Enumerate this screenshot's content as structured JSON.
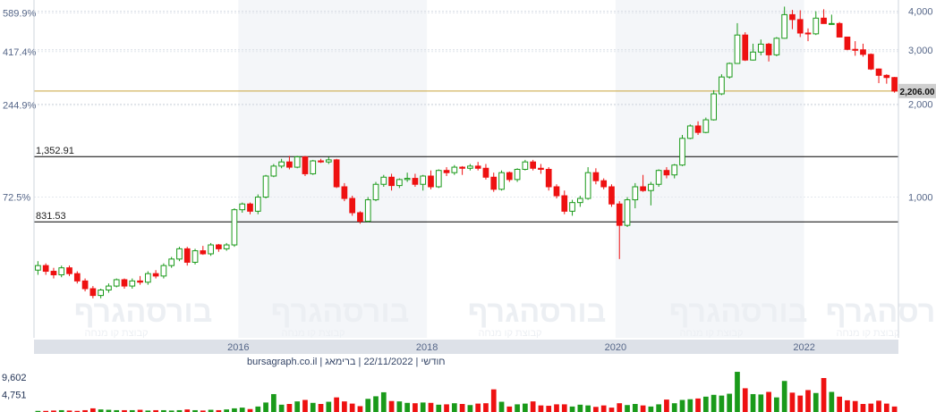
{
  "colors": {
    "up": "#1a9a1a",
    "down": "#ee1111",
    "current_line": "#c9a43c",
    "level_line": "#000000",
    "axis_text": "#556688",
    "band": "#f4f6f9",
    "axis_strip": "#dde1e8"
  },
  "footer_text": "חודשי | 22/11/2022 | ברימאג | bursagraph.co.il",
  "watermark": "בורסהגרף",
  "watermark_sub": "קבוצת קו מנחה",
  "chart_data": {
    "type": "candlestick",
    "period": "monthly",
    "price_axis": {
      "ticks": [
        1000,
        2000,
        3000,
        4000
      ],
      "tick_labels": [
        "1,000",
        "2,000",
        "3,000",
        "4,000"
      ],
      "ylim": [
        350,
        4180
      ]
    },
    "percent_axis": {
      "tick_prices": [
        1000,
        1985,
        2960,
        3950
      ],
      "tick_labels": [
        "72.5%",
        "244.9%",
        "417.4%",
        "589.9%"
      ]
    },
    "x_ticks": [
      {
        "label": "2016",
        "index": 26
      },
      {
        "label": "2018",
        "index": 50
      },
      {
        "label": "2020",
        "index": 74
      },
      {
        "label": "2022",
        "index": 98
      }
    ],
    "current_price": {
      "value": 2206,
      "label": "2,206.00"
    },
    "levels": [
      {
        "value": 1352.91,
        "label": "1,352.91"
      },
      {
        "value": 831.53,
        "label": "831.53"
      }
    ],
    "volume_axis": {
      "ticks": [
        4751,
        9602
      ],
      "tick_labels": [
        "4,751",
        "9,602"
      ],
      "max": 11500
    },
    "candles": [
      {
        "o": 580,
        "h": 620,
        "l": 560,
        "c": 600
      },
      {
        "o": 600,
        "h": 610,
        "l": 560,
        "c": 575
      },
      {
        "o": 575,
        "h": 590,
        "l": 545,
        "c": 560
      },
      {
        "o": 560,
        "h": 600,
        "l": 550,
        "c": 590
      },
      {
        "o": 590,
        "h": 600,
        "l": 555,
        "c": 565
      },
      {
        "o": 565,
        "h": 575,
        "l": 525,
        "c": 535
      },
      {
        "o": 535,
        "h": 545,
        "l": 495,
        "c": 505
      },
      {
        "o": 505,
        "h": 515,
        "l": 470,
        "c": 480
      },
      {
        "o": 480,
        "h": 505,
        "l": 470,
        "c": 500
      },
      {
        "o": 500,
        "h": 525,
        "l": 490,
        "c": 515
      },
      {
        "o": 515,
        "h": 545,
        "l": 510,
        "c": 540
      },
      {
        "o": 540,
        "h": 545,
        "l": 505,
        "c": 515
      },
      {
        "o": 515,
        "h": 545,
        "l": 505,
        "c": 535
      },
      {
        "o": 535,
        "h": 555,
        "l": 520,
        "c": 530
      },
      {
        "o": 530,
        "h": 575,
        "l": 520,
        "c": 565
      },
      {
        "o": 565,
        "h": 580,
        "l": 545,
        "c": 555
      },
      {
        "o": 555,
        "h": 610,
        "l": 545,
        "c": 600
      },
      {
        "o": 600,
        "h": 640,
        "l": 590,
        "c": 630
      },
      {
        "o": 630,
        "h": 690,
        "l": 620,
        "c": 680
      },
      {
        "o": 680,
        "h": 690,
        "l": 600,
        "c": 615
      },
      {
        "o": 615,
        "h": 680,
        "l": 605,
        "c": 670
      },
      {
        "o": 670,
        "h": 695,
        "l": 650,
        "c": 655
      },
      {
        "o": 655,
        "h": 710,
        "l": 645,
        "c": 700
      },
      {
        "o": 700,
        "h": 705,
        "l": 665,
        "c": 680
      },
      {
        "o": 680,
        "h": 710,
        "l": 670,
        "c": 700
      },
      {
        "o": 700,
        "h": 920,
        "l": 690,
        "c": 910
      },
      {
        "o": 910,
        "h": 960,
        "l": 890,
        "c": 950
      },
      {
        "o": 950,
        "h": 960,
        "l": 880,
        "c": 900
      },
      {
        "o": 900,
        "h": 1020,
        "l": 880,
        "c": 1000
      },
      {
        "o": 1000,
        "h": 1180,
        "l": 990,
        "c": 1170
      },
      {
        "o": 1170,
        "h": 1280,
        "l": 1160,
        "c": 1260
      },
      {
        "o": 1260,
        "h": 1330,
        "l": 1240,
        "c": 1300
      },
      {
        "o": 1300,
        "h": 1360,
        "l": 1230,
        "c": 1250
      },
      {
        "o": 1250,
        "h": 1360,
        "l": 1240,
        "c": 1350
      },
      {
        "o": 1350,
        "h": 1360,
        "l": 1170,
        "c": 1190
      },
      {
        "o": 1190,
        "h": 1320,
        "l": 1180,
        "c": 1310
      },
      {
        "o": 1310,
        "h": 1330,
        "l": 1290,
        "c": 1300
      },
      {
        "o": 1300,
        "h": 1350,
        "l": 1280,
        "c": 1320
      },
      {
        "o": 1320,
        "h": 1330,
        "l": 1070,
        "c": 1080
      },
      {
        "o": 1080,
        "h": 1110,
        "l": 970,
        "c": 990
      },
      {
        "o": 990,
        "h": 1010,
        "l": 870,
        "c": 890
      },
      {
        "o": 890,
        "h": 900,
        "l": 820,
        "c": 835
      },
      {
        "o": 835,
        "h": 1000,
        "l": 830,
        "c": 980
      },
      {
        "o": 980,
        "h": 1120,
        "l": 970,
        "c": 1100
      },
      {
        "o": 1100,
        "h": 1180,
        "l": 1080,
        "c": 1160
      },
      {
        "o": 1160,
        "h": 1190,
        "l": 1050,
        "c": 1090
      },
      {
        "o": 1090,
        "h": 1150,
        "l": 1070,
        "c": 1140
      },
      {
        "o": 1140,
        "h": 1200,
        "l": 1120,
        "c": 1150
      },
      {
        "o": 1150,
        "h": 1190,
        "l": 1080,
        "c": 1100
      },
      {
        "o": 1100,
        "h": 1180,
        "l": 1050,
        "c": 1170
      },
      {
        "o": 1170,
        "h": 1220,
        "l": 1060,
        "c": 1080
      },
      {
        "o": 1080,
        "h": 1230,
        "l": 1070,
        "c": 1220
      },
      {
        "o": 1220,
        "h": 1250,
        "l": 1170,
        "c": 1200
      },
      {
        "o": 1200,
        "h": 1270,
        "l": 1180,
        "c": 1250
      },
      {
        "o": 1250,
        "h": 1260,
        "l": 1180,
        "c": 1240
      },
      {
        "o": 1240,
        "h": 1280,
        "l": 1220,
        "c": 1260
      },
      {
        "o": 1260,
        "h": 1300,
        "l": 1220,
        "c": 1240
      },
      {
        "o": 1240,
        "h": 1280,
        "l": 1140,
        "c": 1160
      },
      {
        "o": 1160,
        "h": 1200,
        "l": 1040,
        "c": 1060
      },
      {
        "o": 1060,
        "h": 1220,
        "l": 1050,
        "c": 1200
      },
      {
        "o": 1200,
        "h": 1210,
        "l": 1120,
        "c": 1140
      },
      {
        "o": 1140,
        "h": 1240,
        "l": 1120,
        "c": 1230
      },
      {
        "o": 1230,
        "h": 1320,
        "l": 1220,
        "c": 1300
      },
      {
        "o": 1300,
        "h": 1320,
        "l": 1220,
        "c": 1240
      },
      {
        "o": 1240,
        "h": 1280,
        "l": 1190,
        "c": 1230
      },
      {
        "o": 1230,
        "h": 1250,
        "l": 1050,
        "c": 1080
      },
      {
        "o": 1080,
        "h": 1100,
        "l": 990,
        "c": 1010
      },
      {
        "o": 1010,
        "h": 1050,
        "l": 880,
        "c": 900
      },
      {
        "o": 900,
        "h": 980,
        "l": 870,
        "c": 960
      },
      {
        "o": 960,
        "h": 1010,
        "l": 930,
        "c": 990
      },
      {
        "o": 990,
        "h": 1250,
        "l": 980,
        "c": 1200
      },
      {
        "o": 1200,
        "h": 1240,
        "l": 1100,
        "c": 1130
      },
      {
        "o": 1130,
        "h": 1150,
        "l": 1060,
        "c": 1080
      },
      {
        "o": 1080,
        "h": 1100,
        "l": 930,
        "c": 950
      },
      {
        "o": 950,
        "h": 970,
        "l": 630,
        "c": 810
      },
      {
        "o": 810,
        "h": 1000,
        "l": 800,
        "c": 980
      },
      {
        "o": 980,
        "h": 1110,
        "l": 920,
        "c": 1080
      },
      {
        "o": 1080,
        "h": 1180,
        "l": 1040,
        "c": 1050
      },
      {
        "o": 1050,
        "h": 1120,
        "l": 940,
        "c": 1100
      },
      {
        "o": 1100,
        "h": 1230,
        "l": 1080,
        "c": 1220
      },
      {
        "o": 1220,
        "h": 1250,
        "l": 1150,
        "c": 1180
      },
      {
        "o": 1180,
        "h": 1280,
        "l": 1150,
        "c": 1270
      },
      {
        "o": 1270,
        "h": 1590,
        "l": 1260,
        "c": 1550
      },
      {
        "o": 1550,
        "h": 1720,
        "l": 1540,
        "c": 1700
      },
      {
        "o": 1700,
        "h": 1760,
        "l": 1590,
        "c": 1620
      },
      {
        "o": 1620,
        "h": 1810,
        "l": 1610,
        "c": 1780
      },
      {
        "o": 1780,
        "h": 2220,
        "l": 1770,
        "c": 2160
      },
      {
        "o": 2160,
        "h": 2500,
        "l": 2140,
        "c": 2450
      },
      {
        "o": 2450,
        "h": 2730,
        "l": 2420,
        "c": 2710
      },
      {
        "o": 2710,
        "h": 3660,
        "l": 2700,
        "c": 3350
      },
      {
        "o": 3350,
        "h": 3420,
        "l": 2760,
        "c": 2780
      },
      {
        "o": 2780,
        "h": 3140,
        "l": 2770,
        "c": 2950
      },
      {
        "o": 2950,
        "h": 3240,
        "l": 2880,
        "c": 3130
      },
      {
        "o": 3130,
        "h": 3160,
        "l": 2750,
        "c": 2890
      },
      {
        "o": 2890,
        "h": 3300,
        "l": 2860,
        "c": 3270
      },
      {
        "o": 3270,
        "h": 4140,
        "l": 3260,
        "c": 3900
      },
      {
        "o": 3900,
        "h": 4040,
        "l": 3500,
        "c": 3760
      },
      {
        "o": 3760,
        "h": 4030,
        "l": 3300,
        "c": 3400
      },
      {
        "o": 3400,
        "h": 3520,
        "l": 3200,
        "c": 3380
      },
      {
        "o": 3380,
        "h": 4000,
        "l": 3350,
        "c": 3800
      },
      {
        "o": 3800,
        "h": 4060,
        "l": 3700,
        "c": 3650
      },
      {
        "o": 3650,
        "h": 3900,
        "l": 3620,
        "c": 3650
      },
      {
        "o": 3650,
        "h": 3690,
        "l": 3290,
        "c": 3300
      },
      {
        "o": 3300,
        "h": 3310,
        "l": 2990,
        "c": 3010
      },
      {
        "o": 3010,
        "h": 3200,
        "l": 2870,
        "c": 3000
      },
      {
        "o": 3000,
        "h": 3140,
        "l": 2850,
        "c": 2900
      },
      {
        "o": 2900,
        "h": 2920,
        "l": 2580,
        "c": 2600
      },
      {
        "o": 2600,
        "h": 2610,
        "l": 2340,
        "c": 2480
      },
      {
        "o": 2480,
        "h": 2500,
        "l": 2330,
        "c": 2440
      },
      {
        "o": 2440,
        "h": 2450,
        "l": 2180,
        "c": 2206
      }
    ],
    "volume": [
      300,
      300,
      400,
      500,
      400,
      300,
      500,
      1000,
      700,
      600,
      500,
      500,
      500,
      600,
      400,
      500,
      500,
      400,
      500,
      700,
      500,
      400,
      600,
      500,
      700,
      1000,
      1200,
      800,
      1500,
      2600,
      4900,
      2000,
      2200,
      2900,
      3300,
      2500,
      2200,
      2800,
      4000,
      2900,
      2300,
      1600,
      3600,
      4300,
      5400,
      3000,
      2900,
      2500,
      2400,
      2600,
      2500,
      2000,
      2100,
      2400,
      2200,
      1900,
      2300,
      2400,
      6200,
      2800,
      1500,
      2100,
      2300,
      2900,
      1800,
      1700,
      2100,
      2100,
      1500,
      2000,
      1800,
      1400,
      1800,
      1200,
      2400,
      1900,
      2200,
      1800,
      1500,
      2100,
      3400,
      2400,
      3300,
      3500,
      3700,
      4200,
      4700,
      4500,
      5000,
      11000,
      6500,
      4900,
      4800,
      5500,
      4000,
      8500,
      5300,
      4500,
      6000,
      5200,
      9300,
      5500,
      4200,
      3200,
      3000,
      2200,
      2300,
      3100,
      2300,
      1500
    ]
  }
}
